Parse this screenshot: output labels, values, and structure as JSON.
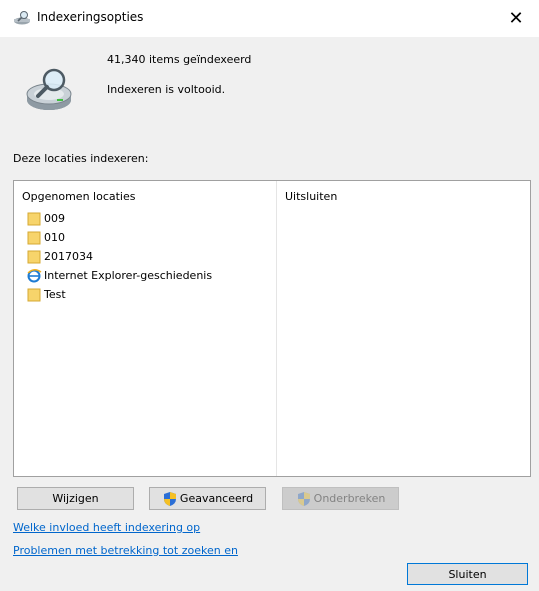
{
  "window": {
    "title": "Indexeringsopties",
    "close_glyph": "✕"
  },
  "status": {
    "count": "41,340 items geïndexeerd",
    "message": "Indexeren is voltooid."
  },
  "section_label": "Deze locaties indexeren:",
  "columns": {
    "included": "Opgenomen locaties",
    "excluded": "Uitsluiten"
  },
  "locations": [
    {
      "label": "009",
      "icon": "folder-icon"
    },
    {
      "label": "010",
      "icon": "folder-icon"
    },
    {
      "label": "2017034",
      "icon": "folder-icon"
    },
    {
      "label": "Internet Explorer-geschiedenis",
      "icon": "internet-explorer-icon"
    },
    {
      "label": "Test",
      "icon": "folder-icon"
    }
  ],
  "buttons": {
    "modify": "Wijzigen",
    "advanced": "Geavanceerd",
    "pause": "Onderbreken",
    "close": "Sluiten"
  },
  "links": {
    "influence": "Welke invloed heeft indexering op",
    "troubleshoot": "Problemen met betrekking tot zoeken en"
  },
  "colors": {
    "link": "#0066cc",
    "folder": "#f7d46b",
    "accent_border": "#0078d7"
  }
}
